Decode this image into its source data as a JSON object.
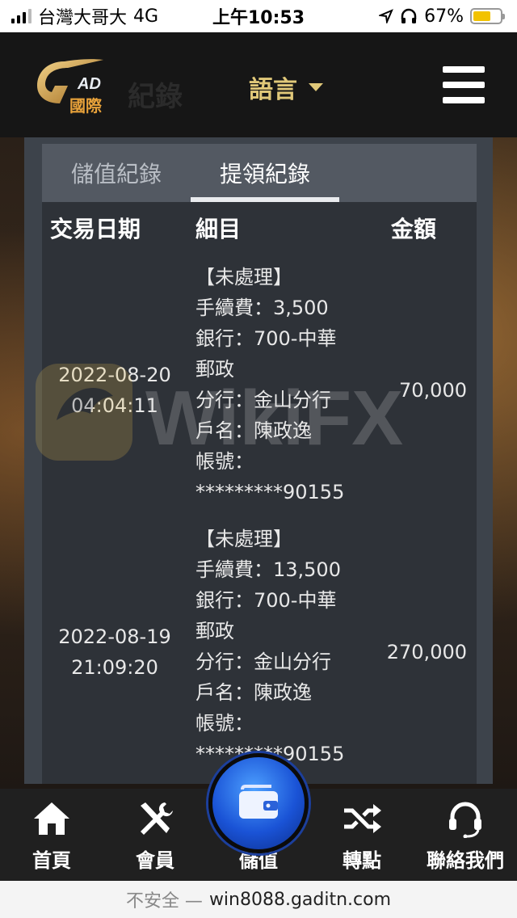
{
  "status_bar": {
    "carrier": "台灣大哥大",
    "network": "4G",
    "time": "上午10:53",
    "battery_percent_text": "67%",
    "battery_level": 0.67
  },
  "header": {
    "logo_text": "AD",
    "logo_sub": "國際",
    "faded_title": "紀錄",
    "language_label": "語言"
  },
  "tabs": [
    {
      "label": "儲值紀錄",
      "active": false
    },
    {
      "label": "提領紀錄",
      "active": true
    }
  ],
  "table": {
    "headers": {
      "date": "交易日期",
      "detail": "細目",
      "amount": "金額"
    },
    "rows": [
      {
        "date": "2022-08-20",
        "time": "04:04:11",
        "detail_lines": [
          "【未處理】",
          "手續費：3,500",
          "銀行：700-中華",
          "郵政",
          "分行：金山分行",
          "戶名：陳政逸",
          "帳號：",
          "*********90155"
        ],
        "amount": "70,000"
      },
      {
        "date": "2022-08-19",
        "time": "21:09:20",
        "detail_lines": [
          "【未處理】",
          "手續費：13,500",
          "銀行：700-中華",
          "郵政",
          "分行：金山分行",
          "戶名：陳政逸",
          "帳號：",
          "*********90155"
        ],
        "amount": "270,000"
      }
    ]
  },
  "watermark": "WikiFX",
  "bottom_nav": [
    {
      "label": "首頁",
      "icon": "home-icon"
    },
    {
      "label": "會員",
      "icon": "tools-icon"
    },
    {
      "label": "儲值",
      "icon": "wallet-icon"
    },
    {
      "label": "轉點",
      "icon": "shuffle-icon"
    },
    {
      "label": "聯絡我們",
      "icon": "headset-icon"
    }
  ],
  "url_bar": {
    "security_label": "不安全 —",
    "url": "win8088.gaditn.com"
  },
  "colors": {
    "accent_gold": "#e0c879",
    "panel": "#3d434b",
    "table_bg": "#2e3238",
    "center_button_blue": "#1a53d6"
  }
}
